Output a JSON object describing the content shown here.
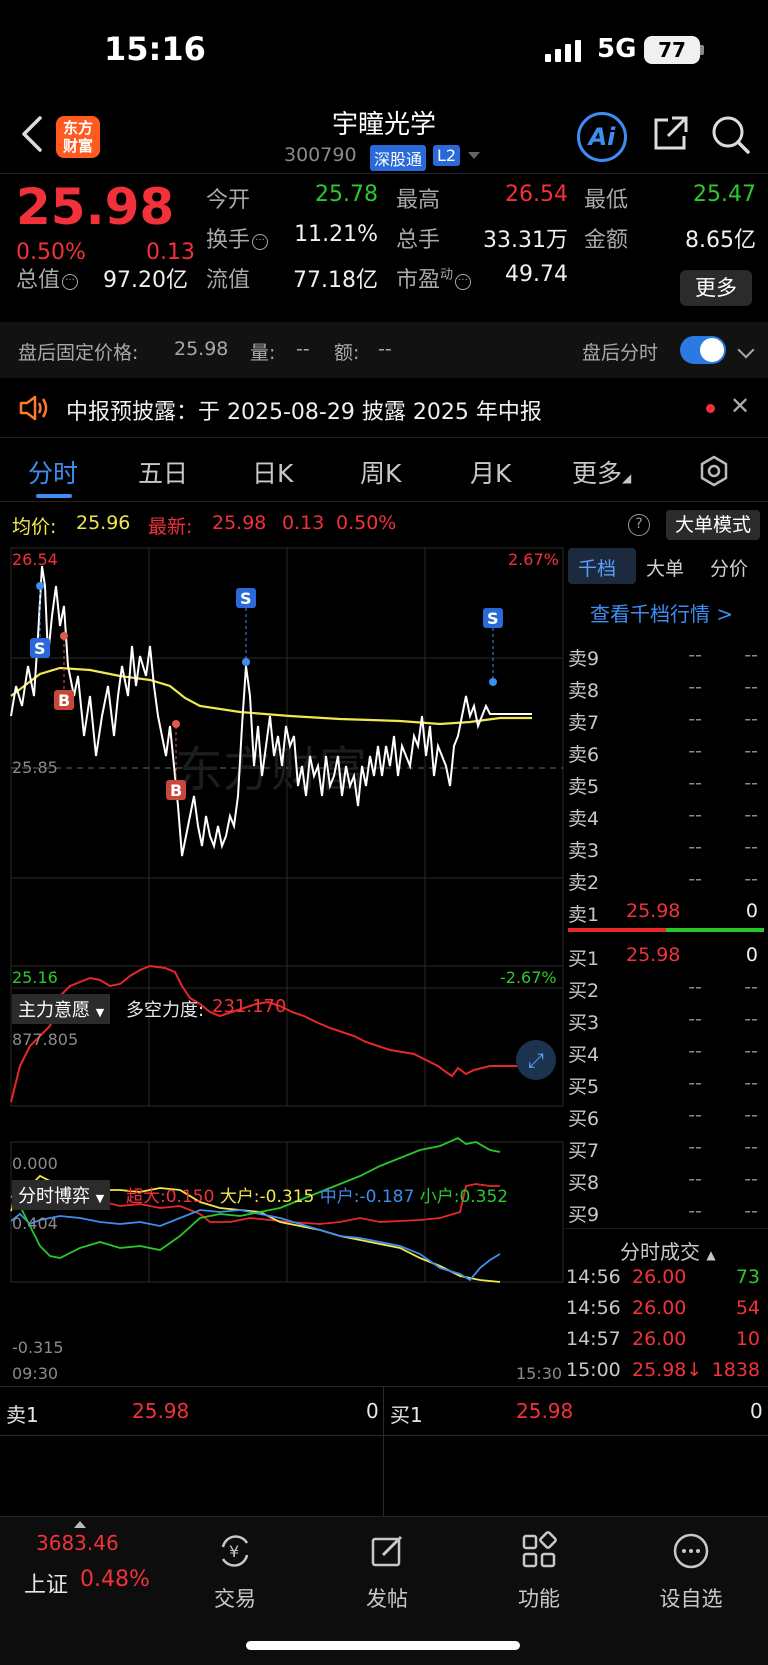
{
  "status": {
    "time": "15:16",
    "network": "5G",
    "battery": "77"
  },
  "header": {
    "logo_line1": "东方",
    "logo_line2": "财富",
    "name": "宇瞳光学",
    "code": "300790",
    "tag_connect": "深股通",
    "tag_level": "L2",
    "ai_label": "Ai"
  },
  "quote": {
    "price": "25.98",
    "pct": "0.50%",
    "change": "0.13",
    "open_label": "今开",
    "open": "25.78",
    "high_label": "最高",
    "high": "26.54",
    "low_label": "最低",
    "low": "25.47",
    "turnover_label": "换手",
    "turnover": "11.21%",
    "volume_label": "总手",
    "volume": "33.31万",
    "amount_label": "金额",
    "amount": "8.65亿",
    "mktcap_label": "总值",
    "mktcap": "97.20亿",
    "float_label": "流值",
    "float": "77.18亿",
    "pe_label": "市盈",
    "pe_sup": "动",
    "pe": "49.74",
    "more": "更多"
  },
  "after_hours": {
    "price_label": "盘后固定价格:",
    "price": "25.98",
    "vol_label": "量:",
    "vol": "--",
    "amt_label": "额:",
    "amt": "--",
    "switch_label": "盘后分时"
  },
  "notice": {
    "text": "中报预披露：于 2025-08-29 披露 2025 年中报"
  },
  "tabs": [
    "分时",
    "五日",
    "日K",
    "周K",
    "月K",
    "更多"
  ],
  "chart_header": {
    "avg_label": "均价:",
    "avg": "25.96",
    "latest_label": "最新:",
    "latest": "25.98",
    "latest_chg": "0.13",
    "latest_pct": "0.50%",
    "big_mode": "大单模式"
  },
  "main_chart": {
    "y_top": "26.54",
    "y_mid": "25.85",
    "y_bottom": "25.16",
    "pct_top": "2.67%",
    "pct_bottom": "-2.67%"
  },
  "indicator1": {
    "name": "主力意愿",
    "label": "多空力度:",
    "value": "231.170",
    "y_top": "877.805",
    "y_bottom": "0.000"
  },
  "indicator2": {
    "name": "分时博弈",
    "s1_label": "超大:",
    "s1": "0.150",
    "s2_label": "大户:",
    "s2": "-0.315",
    "s3_label": "中户:",
    "s3": "-0.187",
    "s4_label": "小户:",
    "s4": "0.352",
    "y_top": "0.404",
    "y_bottom": "-0.315",
    "x_start": "09:30",
    "x_end": "15:30"
  },
  "book": {
    "tabs": [
      "千档",
      "大单",
      "分价"
    ],
    "link": "查看千档行情 >",
    "asks": [
      {
        "label": "卖9",
        "price": "--",
        "vol": "--"
      },
      {
        "label": "卖8",
        "price": "--",
        "vol": "--"
      },
      {
        "label": "卖7",
        "price": "--",
        "vol": "--"
      },
      {
        "label": "卖6",
        "price": "--",
        "vol": "--"
      },
      {
        "label": "卖5",
        "price": "--",
        "vol": "--"
      },
      {
        "label": "卖4",
        "price": "--",
        "vol": "--"
      },
      {
        "label": "卖3",
        "price": "--",
        "vol": "--"
      },
      {
        "label": "卖2",
        "price": "--",
        "vol": "--"
      },
      {
        "label": "卖1",
        "price": "25.98",
        "vol": "0"
      }
    ],
    "bids": [
      {
        "label": "买1",
        "price": "25.98",
        "vol": "0"
      },
      {
        "label": "买2",
        "price": "--",
        "vol": "--"
      },
      {
        "label": "买3",
        "price": "--",
        "vol": "--"
      },
      {
        "label": "买4",
        "price": "--",
        "vol": "--"
      },
      {
        "label": "买5",
        "price": "--",
        "vol": "--"
      },
      {
        "label": "买6",
        "price": "--",
        "vol": "--"
      },
      {
        "label": "买7",
        "price": "--",
        "vol": "--"
      },
      {
        "label": "买8",
        "price": "--",
        "vol": "--"
      },
      {
        "label": "买9",
        "price": "--",
        "vol": "--"
      }
    ],
    "trades_title": "分时成交",
    "trades": [
      {
        "time": "14:56",
        "price": "26.00",
        "vol": "73",
        "vcolor": "#2ec82e"
      },
      {
        "time": "14:56",
        "price": "26.00",
        "vol": "54",
        "vcolor": "#f2313a"
      },
      {
        "time": "14:57",
        "price": "26.00",
        "vol": "10",
        "vcolor": "#f2313a"
      },
      {
        "time": "15:00",
        "price": "25.98↓",
        "vol": "1838",
        "vcolor": "#f2313a"
      }
    ]
  },
  "bottom_quote": {
    "left_label": "卖1",
    "left_price": "25.98",
    "left_vol": "0",
    "right_label": "买1",
    "right_price": "25.98",
    "right_vol": "0"
  },
  "nav": {
    "index_value": "3683.46",
    "index_name": "上证",
    "index_pct": "0.48%",
    "items": [
      "交易",
      "发帖",
      "功能",
      "设自选"
    ],
    "trade_icon_glyph": "¥"
  },
  "markers": {
    "buy": "B",
    "sell": "S"
  }
}
